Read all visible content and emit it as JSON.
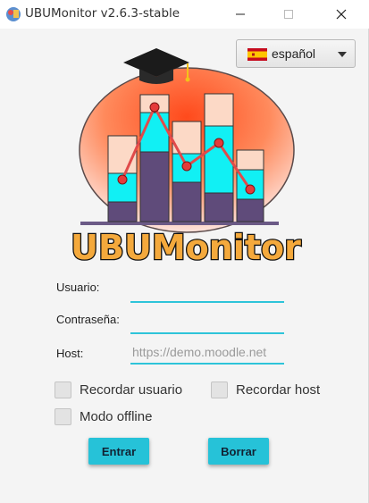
{
  "window": {
    "title": "UBUMonitor v2.6.3-stable",
    "controls": [
      "minimize",
      "maximize",
      "close"
    ]
  },
  "language": {
    "selected": "español",
    "flag_icon": "spain-flag-icon"
  },
  "logo": {
    "text": "UBUMonitor",
    "icon": "graduation-cap-bar-chart-logo"
  },
  "form": {
    "user_label": "Usuario:",
    "user_value": "",
    "password_label": "Contraseña:",
    "password_value": "",
    "host_label": "Host:",
    "host_placeholder": "https://demo.moodle.net"
  },
  "options": {
    "remember_user": "Recordar usuario",
    "remember_host": "Recordar host",
    "offline_mode": "Modo offline"
  },
  "buttons": {
    "login": "Entrar",
    "clear": "Borrar"
  },
  "colors": {
    "accent": "#26c2d8",
    "logo_text": "#f4a93c"
  }
}
